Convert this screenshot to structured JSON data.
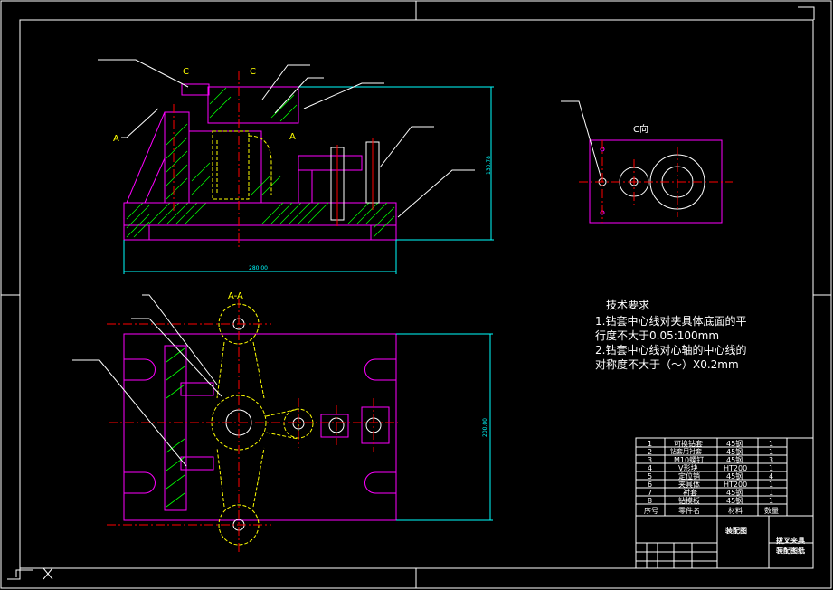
{
  "sheet": {
    "bg_color": "#000000",
    "frame_color": "#ffffff",
    "part_color": "#ff00ff",
    "center_color": "#ff0000",
    "hidden_color": "#ffff00",
    "hatch_color": "#00ff00",
    "dim_color": "#00ffff"
  },
  "views": {
    "section_label_c_left": "C",
    "section_label_c_right": "C",
    "section_label_a_left": "A",
    "section_label_a_right": "A",
    "section_aa_title": "A-A",
    "view_c_title": "C向"
  },
  "tech_requirements": {
    "title": "技术要求",
    "line1": "1.钻套中心线对夹具体底面的平",
    "line2": "行度不大于0.05:100mm",
    "line3": "2.钻套中心线对心轴的中心线的",
    "line4": "对称度不大于（～）X0.2mm"
  },
  "parts_table": {
    "rows": [
      {
        "no": "1",
        "name": "可换钻套",
        "material": "45钢",
        "qty": "1"
      },
      {
        "no": "2",
        "name": "钻套用衬套",
        "material": "45钢",
        "qty": "1"
      },
      {
        "no": "3",
        "name": "M10螺钉",
        "material": "45钢",
        "qty": "3"
      },
      {
        "no": "4",
        "name": "V形块",
        "material": "HT200",
        "qty": "1"
      },
      {
        "no": "5",
        "name": "定位销",
        "material": "45钢",
        "qty": "4"
      },
      {
        "no": "6",
        "name": "夹具体",
        "material": "HT200",
        "qty": "1"
      },
      {
        "no": "7",
        "name": "衬套",
        "material": "45钢",
        "qty": "1"
      },
      {
        "no": "8",
        "name": "钻模板",
        "material": "45钢",
        "qty": "1"
      }
    ],
    "header": {
      "no": "序号",
      "name": "零件名",
      "material": "材料",
      "qty": "数量"
    },
    "title_block_name": "装配图",
    "title_block_product": "拨叉夹具",
    "title_block_sub": "装配图纸"
  },
  "dims": {
    "width_dim": "280.00",
    "height_dim": "130.78",
    "side_dim": "200.00"
  }
}
